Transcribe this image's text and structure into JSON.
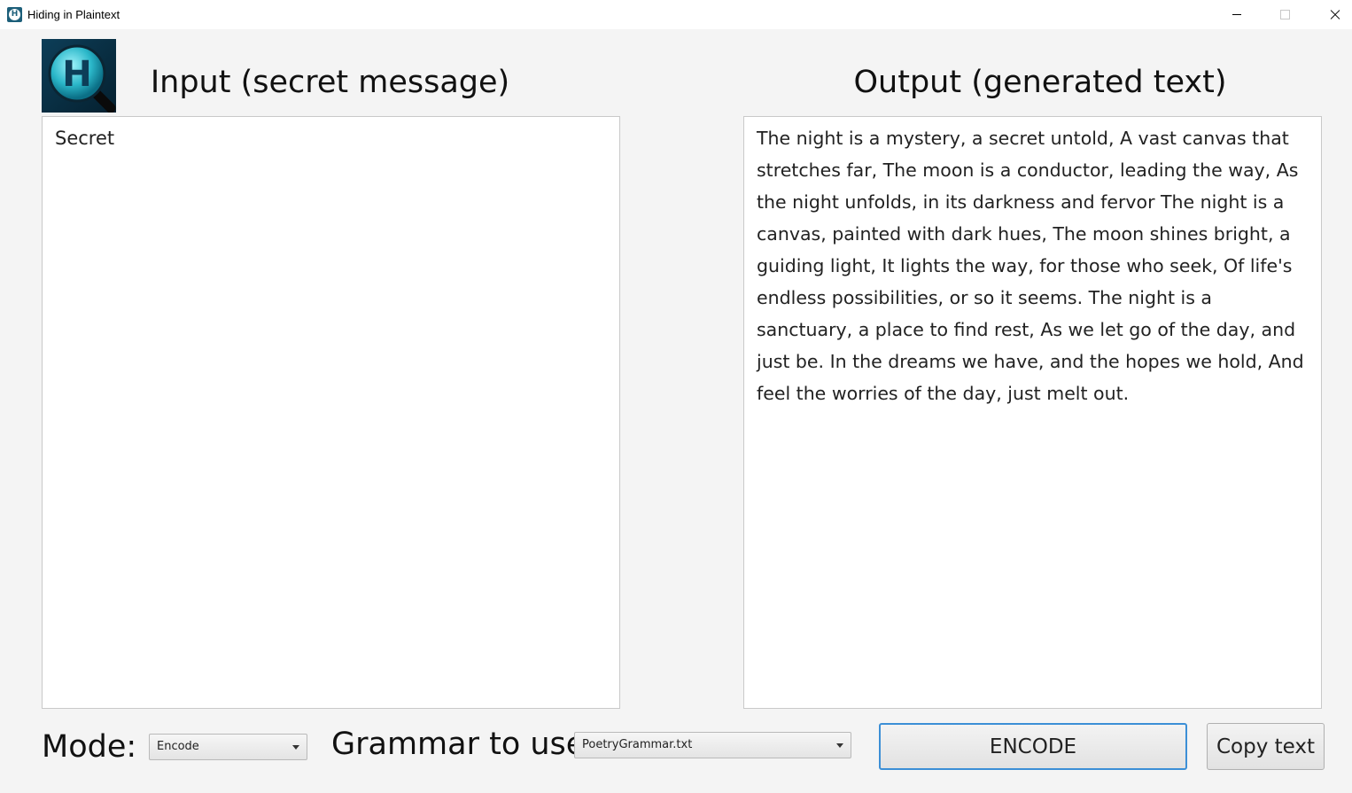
{
  "window": {
    "title": "Hiding in Plaintext",
    "icon": "app-h-magnifier-icon",
    "controls": [
      "minimize-icon",
      "maximize-icon",
      "close-icon"
    ]
  },
  "logo": {
    "letter": "H",
    "icon": "h-magnifier-logo-icon"
  },
  "input": {
    "heading": "Input (secret message)",
    "value": "Secret"
  },
  "output": {
    "heading": "Output (generated text)",
    "value": "The night is a mystery, a secret untold, A vast canvas that stretches far, The moon is a conductor, leading the way, As the night unfolds, in its darkness and fervor The night is a canvas, painted with dark hues, The moon shines bright, a guiding light, It lights the way, for those who seek, Of life's endless possibilities, or so it seems. The night is a sanctuary, a place to find rest, As we let go of the day, and just be. In the dreams we have, and the hopes we hold, And feel the worries of the day, just melt out."
  },
  "controls": {
    "mode_label": "Mode:",
    "mode_value": "Encode",
    "grammar_label": "Grammar to use:",
    "grammar_value": "PoetryGrammar.txt",
    "encode_button": "ENCODE",
    "copy_button": "Copy text"
  },
  "colors": {
    "background": "#f4f4f4",
    "focus_border": "#3c8fd6",
    "logo_teal": "#2bb7c9"
  }
}
